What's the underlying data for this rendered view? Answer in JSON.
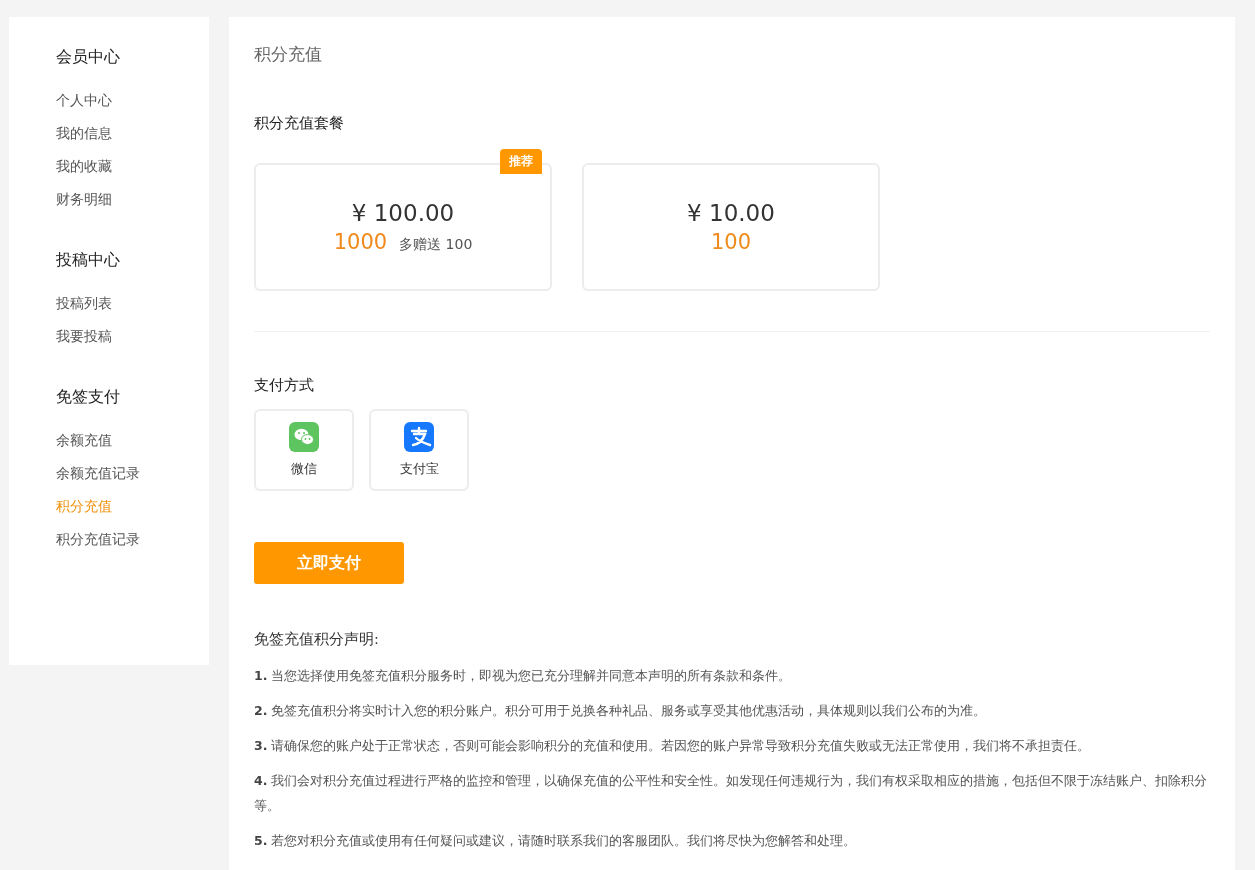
{
  "sidebar": {
    "groups": [
      {
        "title": "会员中心",
        "items": [
          {
            "label": "个人中心",
            "selected": false
          },
          {
            "label": "我的信息",
            "selected": false
          },
          {
            "label": "我的收藏",
            "selected": false
          },
          {
            "label": "财务明细",
            "selected": false
          }
        ]
      },
      {
        "title": "投稿中心",
        "items": [
          {
            "label": "投稿列表",
            "selected": false
          },
          {
            "label": "我要投稿",
            "selected": false
          }
        ]
      },
      {
        "title": "免签支付",
        "items": [
          {
            "label": "余额充值",
            "selected": false
          },
          {
            "label": "余额充值记录",
            "selected": false
          },
          {
            "label": "积分充值",
            "selected": true
          },
          {
            "label": "积分充值记录",
            "selected": false
          }
        ]
      }
    ]
  },
  "page_title": "积分充值",
  "packages_title": "积分充值套餐",
  "packages": [
    {
      "price": "¥ 100.00",
      "points": "1000",
      "bonus": "多赠送 100",
      "badge": "推荐"
    },
    {
      "price": "¥ 10.00",
      "points": "100"
    }
  ],
  "payment_title": "支付方式",
  "payment_methods": [
    {
      "kind": "wechat",
      "label": "微信"
    },
    {
      "kind": "alipay",
      "label": "支付宝"
    }
  ],
  "pay_button": "立即支付",
  "notice": {
    "title": "免签充值积分声明:",
    "items": [
      "**1.** 当您选择使用免签充值积分服务时，即视为您已充分理解并同意本声明的所有条款和条件。",
      "**2.** 免签充值积分将实时计入您的积分账户。积分可用于兑换各种礼品、服务或享受其他优惠活动，具体规则以我们公布的为准。",
      "**3.** 请确保您的账户处于正常状态，否则可能会影响积分的充值和使用。若因您的账户异常导致积分充值失败或无法正常使用，我们将不承担责任。",
      "**4.** 我们会对积分充值过程进行严格的监控和管理，以确保充值的公平性和安全性。如发现任何违规行为，我们有权采取相应的措施，包括但不限于冻结账户、扣除积分等。",
      "**5.** 若您对积分充值或使用有任何疑问或建议，请随时联系我们的客服团队。我们将尽快为您解答和处理。"
    ]
  }
}
